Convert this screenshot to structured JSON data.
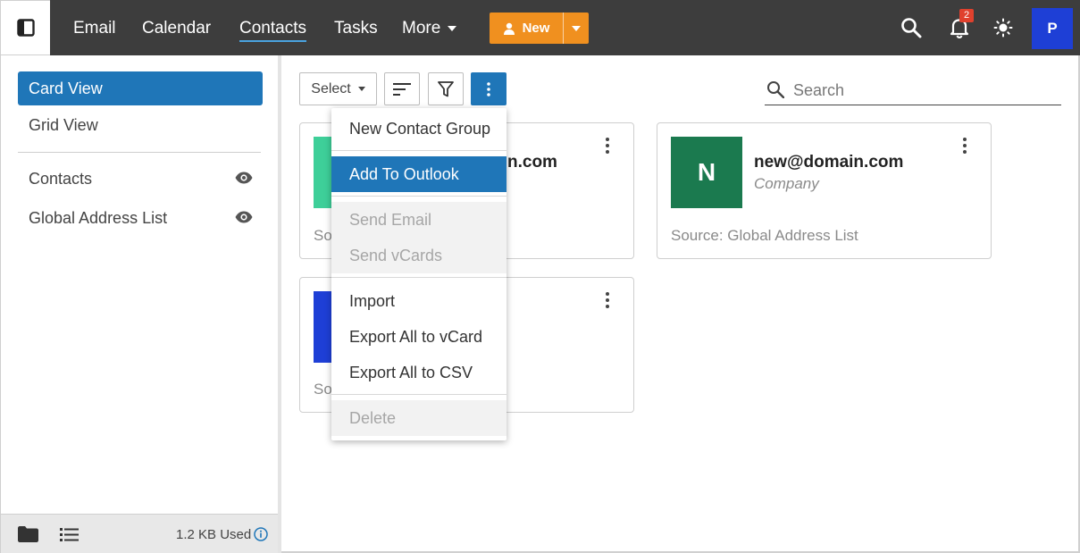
{
  "header": {
    "nav": [
      {
        "label": "Email"
      },
      {
        "label": "Calendar"
      },
      {
        "label": "Contacts",
        "active": true
      },
      {
        "label": "Tasks"
      },
      {
        "label": "More"
      }
    ],
    "new_label": "New",
    "notification_count": "2",
    "avatar_initial": "P"
  },
  "sidebar": {
    "views": [
      {
        "label": "Card View",
        "active": true
      },
      {
        "label": "Grid View"
      }
    ],
    "sources": [
      {
        "label": "Contacts",
        "icon": "eye-icon"
      },
      {
        "label": "Global Address List",
        "icon": "eye-icon"
      }
    ],
    "storage_used": "1.2 KB Used"
  },
  "toolbar": {
    "select_label": "Select",
    "search_placeholder": "Search"
  },
  "cards": [
    {
      "avatar_color": "#3ecf99",
      "name_fragment": "n.com",
      "source_fragment": "So"
    },
    {
      "avatar_letter": "N",
      "avatar_color": "#1b7a4f",
      "name": "new@domain.com",
      "company": "Company",
      "source": "Source: Global Address List"
    },
    {
      "avatar_color": "#1e3fd6",
      "source_fragment": "So"
    }
  ],
  "menu": {
    "items": [
      {
        "label": "New Contact Group"
      },
      {
        "label": "Add To Outlook",
        "highlighted": true
      },
      {
        "label": "Send Email",
        "disabled": true
      },
      {
        "label": "Send vCards",
        "disabled": true
      },
      {
        "label": "Import"
      },
      {
        "label": "Export All to vCard"
      },
      {
        "label": "Export All to CSV"
      },
      {
        "label": "Delete",
        "disabled": true
      }
    ]
  },
  "colors": {
    "topbar": "#3d3d3d",
    "accent_blue": "#1f76b8",
    "new_orange": "#f0901f",
    "badge_red": "#e0412d"
  }
}
